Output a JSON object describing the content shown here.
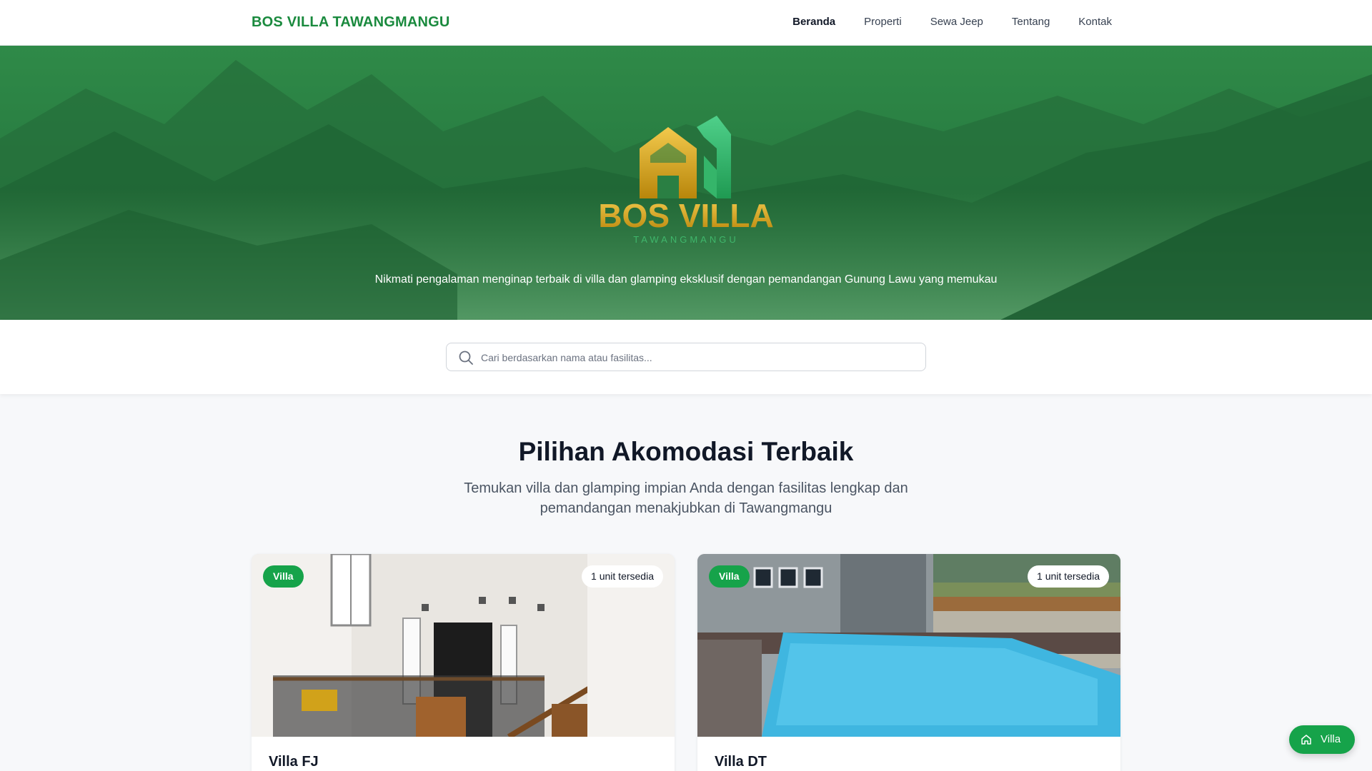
{
  "nav": {
    "brand": "BOS VILLA TAWANGMANGU",
    "items": [
      {
        "label": "Beranda",
        "active": true
      },
      {
        "label": "Properti",
        "active": false
      },
      {
        "label": "Sewa Jeep",
        "active": false
      },
      {
        "label": "Tentang",
        "active": false
      },
      {
        "label": "Kontak",
        "active": false
      }
    ]
  },
  "hero": {
    "logo_text": "BOS VILLA",
    "logo_subtext": "TAWANGMANGU",
    "subtitle": "Nikmati pengalaman menginap terbaik di villa dan glamping eksklusif dengan pemandangan Gunung Lawu yang memukau"
  },
  "search": {
    "placeholder": "Cari berdasarkan nama atau fasilitas...",
    "value": ""
  },
  "section": {
    "title": "Pilihan Akomodasi Terbaik",
    "subtitle": "Temukan villa dan glamping impian Anda dengan fasilitas lengkap dan pemandangan menakjubkan di Tawangmangu"
  },
  "cards": [
    {
      "type": "Villa",
      "availability": "1 unit tersedia",
      "name": "Villa FJ"
    },
    {
      "type": "Villa",
      "availability": "1 unit tersedia",
      "name": "Villa DT"
    }
  ],
  "fab": {
    "label": "Villa",
    "icon": "home-icon"
  },
  "colors": {
    "brand": "#1a8a3e",
    "accent": "#16a34a",
    "hero_overlay": "#2a7f43",
    "logo_gold": "#d4a017"
  }
}
